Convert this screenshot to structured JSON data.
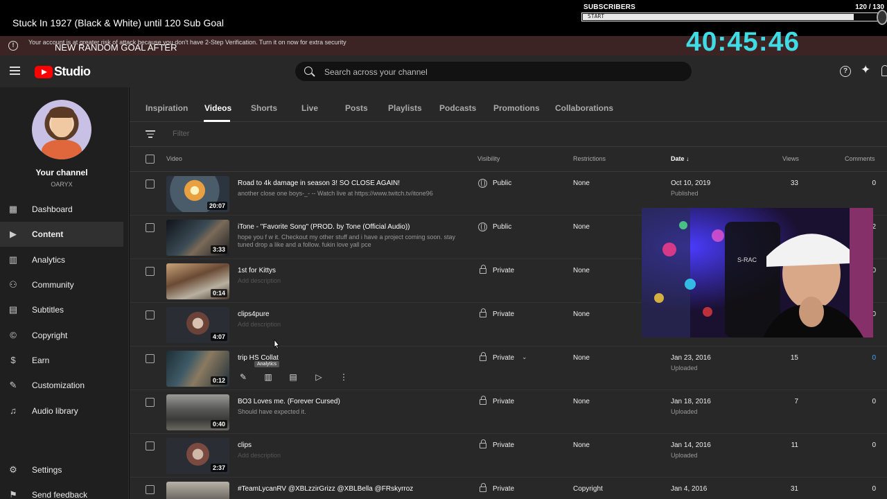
{
  "stream": {
    "title": "Stuck In 1927 (Black & White) until 120 Sub Goal",
    "goal_after": "NEW RANDOM GOAL AFTER",
    "timer": "40:45:46",
    "subs_label": "SUBSCRIBERS",
    "subs_count": "120  / 130",
    "subs_start": "START",
    "subs_progress": 0.923
  },
  "warning": {
    "text": "Your account is at greater risk of attack because you don't have 2-Step Verification. Turn it on now for extra security"
  },
  "header": {
    "logo_text": "Studio",
    "search_placeholder": "Search across your channel"
  },
  "channel": {
    "label": "Your channel",
    "handle": "OARYX"
  },
  "sidebar": {
    "items": [
      {
        "label": "Dashboard",
        "icon": "dashboard-icon"
      },
      {
        "label": "Content",
        "icon": "content-icon",
        "active": true
      },
      {
        "label": "Analytics",
        "icon": "analytics-icon"
      },
      {
        "label": "Community",
        "icon": "community-icon"
      },
      {
        "label": "Subtitles",
        "icon": "subtitles-icon"
      },
      {
        "label": "Copyright",
        "icon": "copyright-icon"
      },
      {
        "label": "Earn",
        "icon": "earn-icon"
      },
      {
        "label": "Customization",
        "icon": "customization-icon"
      },
      {
        "label": "Audio library",
        "icon": "audio-library-icon"
      }
    ],
    "settings": "Settings",
    "feedback": "Send feedback"
  },
  "tabs": [
    "Inspiration",
    "Videos",
    "Shorts",
    "Live",
    "Posts",
    "Playlists",
    "Podcasts",
    "Promotions",
    "Collaborations"
  ],
  "filter_placeholder": "Filter",
  "columns": {
    "video": "Video",
    "visibility": "Visibility",
    "restrictions": "Restrictions",
    "date": "Date",
    "views": "Views",
    "comments": "Comments"
  },
  "videos": [
    {
      "title": "Road to 4k damage in season 3! SO CLOSE AGAIN!",
      "description": "another close one boys-_- -- Watch live at https://www.twitch.tv/itone96",
      "duration": "20:07",
      "visibility": "Public",
      "restrictions": "None",
      "date": "Oct 10, 2019",
      "status": "Published",
      "views": "33",
      "comments": "0"
    },
    {
      "title": "iTone - \"Favorite Song\" (PROD. by Tone (Official Audio))",
      "description": "hope you f w it. Checkout my other stuff and i have a project coming soon. stay tuned drop a like and a follow. fukin love yall pce",
      "duration": "3:33",
      "visibility": "Public",
      "restrictions": "None",
      "date": "",
      "status": "",
      "views": "",
      "comments": "2"
    },
    {
      "title": "1st for Kittys",
      "description": "Add description",
      "duration": "0:14",
      "visibility": "Private",
      "restrictions": "None",
      "date": "",
      "status": "",
      "views": "",
      "comments": "0"
    },
    {
      "title": "clips4pure",
      "description": "Add description",
      "duration": "4:07",
      "visibility": "Private",
      "restrictions": "None",
      "date": "",
      "status": "",
      "views": "",
      "comments": "0"
    },
    {
      "title": "trip HS Collat",
      "description": "",
      "duration": "0:12",
      "visibility": "Private",
      "restrictions": "None",
      "date": "Jan 23, 2016",
      "status": "Uploaded",
      "views": "15",
      "comments": "0"
    },
    {
      "title": "BO3 Loves me. (Forever Cursed)",
      "description": "Should have expected it.",
      "duration": "0:40",
      "visibility": "Private",
      "restrictions": "None",
      "date": "Jan 18, 2016",
      "status": "Uploaded",
      "views": "7",
      "comments": "0"
    },
    {
      "title": "clips",
      "description": "Add description",
      "duration": "2:37",
      "visibility": "Private",
      "restrictions": "None",
      "date": "Jan 14, 2016",
      "status": "Uploaded",
      "views": "11",
      "comments": "0"
    },
    {
      "title": "#TeamLycanRV @XBLzzirGrizz @XBLBella @FRskyrroz",
      "description": "",
      "duration": "",
      "visibility": "Private",
      "restrictions": "Copyright",
      "date": "Jan 4, 2016",
      "status": "",
      "views": "31",
      "comments": "0"
    }
  ],
  "tooltip": "Analytics",
  "colors": {
    "accent_timer": "#3fdce6",
    "brand_red": "#ff0000",
    "link_blue": "#3ea6ff",
    "warning_bg": "#3d2424"
  }
}
